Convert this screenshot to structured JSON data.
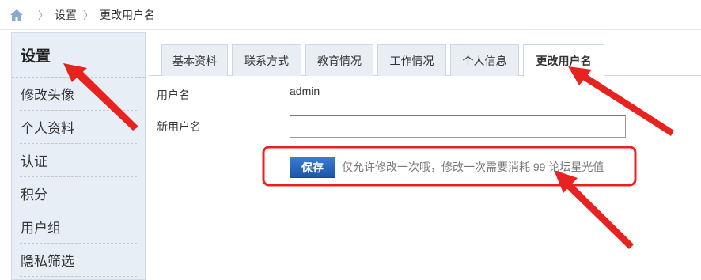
{
  "breadcrumb": {
    "icon": "home-icon",
    "items": [
      "设置",
      "更改用户名"
    ]
  },
  "sidebar": {
    "title": "设置",
    "items": [
      {
        "label": "修改头像"
      },
      {
        "label": "个人资料"
      },
      {
        "label": "认证"
      },
      {
        "label": "积分"
      },
      {
        "label": "用户组"
      },
      {
        "label": "隐私筛选"
      }
    ]
  },
  "tabs": [
    {
      "label": "基本资料",
      "active": false
    },
    {
      "label": "联系方式",
      "active": false
    },
    {
      "label": "教育情况",
      "active": false
    },
    {
      "label": "工作情况",
      "active": false
    },
    {
      "label": "个人信息",
      "active": false
    },
    {
      "label": "更改用户名",
      "active": true
    }
  ],
  "form": {
    "username_label": "用户名",
    "username_value": "admin",
    "new_username_label": "新用户名",
    "new_username_value": "",
    "save_label": "保存",
    "hint": "仅允许修改一次哦，修改一次需要消耗 99 论坛星光值"
  },
  "colors": {
    "annotation_red": "#e8231f",
    "button_blue": "#2563b8",
    "sidebar_bg": "#e8eef6",
    "tab_bg": "#e9eef5"
  }
}
